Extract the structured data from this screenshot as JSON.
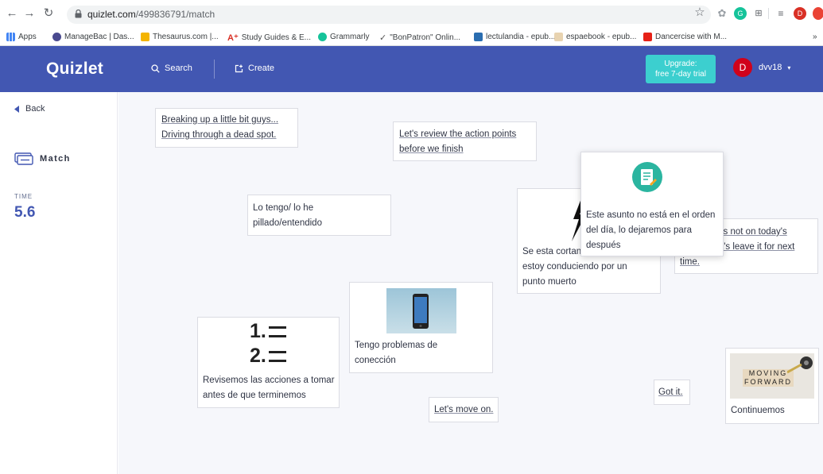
{
  "browser": {
    "url_host": "quizlet.com",
    "url_path": "/499836791/match",
    "bookmarks": [
      {
        "label": "Apps"
      },
      {
        "label": "ManageBac | Das..."
      },
      {
        "label": "Thesaurus.com |..."
      },
      {
        "label": "Study Guides & E..."
      },
      {
        "label": "Grammarly"
      },
      {
        "label": "\"BonPatron\" Onlin..."
      },
      {
        "label": "lectulandia - epub..."
      },
      {
        "label": "espaebook - epub..."
      },
      {
        "label": "Dancercise with M..."
      }
    ],
    "profile_initial": "D"
  },
  "header": {
    "logo": "Quizlet",
    "search_label": "Search",
    "create_label": "Create",
    "upgrade_line1": "Upgrade:",
    "upgrade_line2": "free 7-day trial",
    "avatar_initial": "D",
    "username": "dvv18"
  },
  "sidebar": {
    "back_label": "Back",
    "mode_label": "Match",
    "time_label": "TIME",
    "time_value": "5.6"
  },
  "cards": {
    "c1_l1": "Breaking up a little bit guys...",
    "c1_l2": "Driving through a dead spot.",
    "c2_l1": "Let's review the action points",
    "c2_l2": "before we finish",
    "c3_l1": "Lo tengo/ lo he",
    "c3_l2": "pillado/entendido",
    "c4_l1": "Se esta cortan",
    "c4_l2": "estoy conduciendo por un",
    "c4_l3": "punto muerto",
    "c5_l1": "Este asunto no está en el orden",
    "c5_l2": "del día, lo dejaremos para",
    "c5_l3": "después",
    "c6_l1": "is not on today's",
    "c6_l2": "t's leave it for next",
    "c6_l3": "time.",
    "c7_l1": "Tengo problemas de",
    "c7_l2": "conección",
    "c8_l1": "Revisemos las acciones a tomar",
    "c8_l2": "antes de que terminemos",
    "c9": "Let's move on.",
    "c10": "Got it.",
    "c11": "Continuemos",
    "moving_forward_l1": "MOVING",
    "moving_forward_l2": "FORWARD",
    "list_1": "1.",
    "list_2": "2."
  },
  "colors": {
    "brand": "#4257b2",
    "upgrade": "#3ccfcf",
    "avatar": "#d0021b",
    "time": "#4257b2"
  }
}
